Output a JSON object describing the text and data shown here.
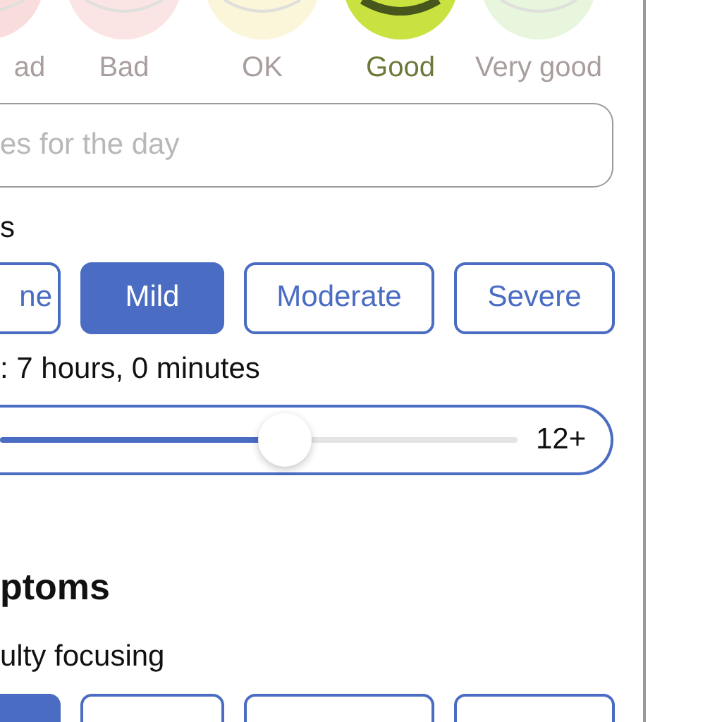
{
  "moods": [
    {
      "label": "ad",
      "color": "#f9dcdc",
      "selected": false
    },
    {
      "label": "Bad",
      "color": "#fbe4e4",
      "selected": false
    },
    {
      "label": "OK",
      "color": "#fbf5d9",
      "selected": false
    },
    {
      "label": "Good",
      "color": "#c9e240",
      "selected": true
    },
    {
      "label": "Very good",
      "color": "#e7f6dc",
      "selected": false
    }
  ],
  "notes": {
    "placeholder": "es for the day"
  },
  "severity_label": "s",
  "severity": [
    {
      "label": "ne",
      "selected": false
    },
    {
      "label": "Mild",
      "selected": true
    },
    {
      "label": "Moderate",
      "selected": false
    },
    {
      "label": "Severe",
      "selected": false
    }
  ],
  "sleep": {
    "label": ": 7 hours, 0 minutes",
    "level": 0.55,
    "max_label": "12+"
  },
  "symptoms_heading": "ptoms",
  "symptom": {
    "label": "ulty focusing",
    "options": [
      {
        "selected": true
      },
      {
        "selected": false
      },
      {
        "selected": false
      },
      {
        "selected": false
      }
    ]
  }
}
